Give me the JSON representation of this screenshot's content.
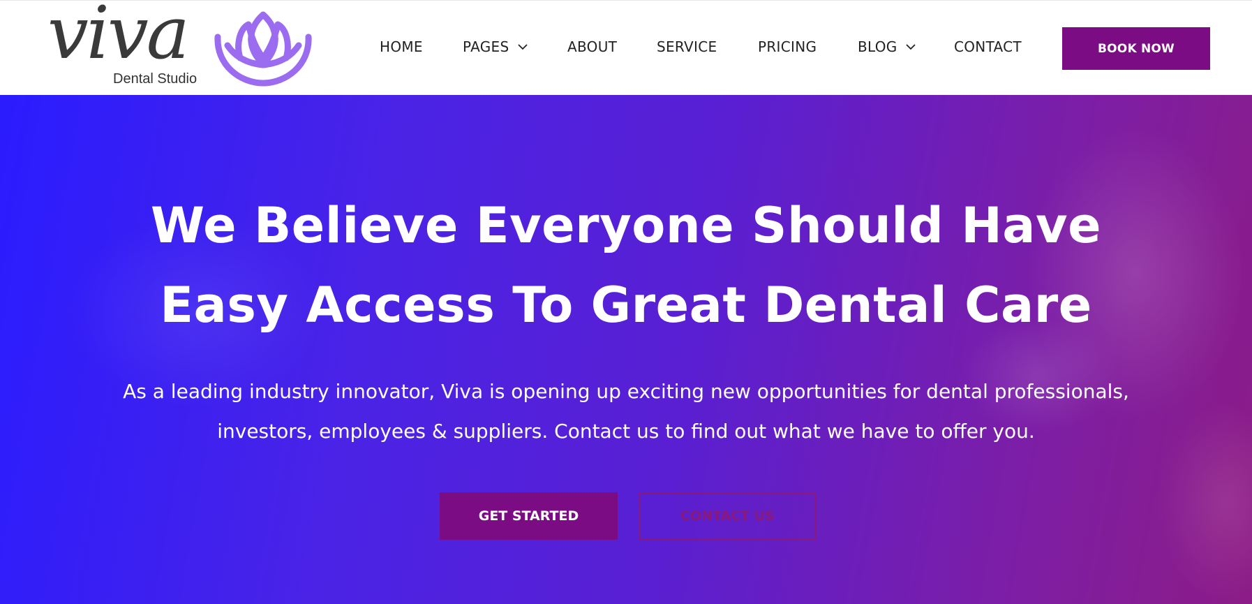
{
  "brand": {
    "name": "viva",
    "subtitle": "Dental Studio",
    "accent_color": "#9b6bf0",
    "primary_color": "#7b0c84"
  },
  "nav": {
    "items": [
      {
        "label": "HOME",
        "has_dropdown": false
      },
      {
        "label": "PAGES",
        "has_dropdown": true
      },
      {
        "label": "ABOUT",
        "has_dropdown": false
      },
      {
        "label": "SERVICE",
        "has_dropdown": false
      },
      {
        "label": "PRICING",
        "has_dropdown": false
      },
      {
        "label": "BLOG",
        "has_dropdown": true
      },
      {
        "label": "CONTACT",
        "has_dropdown": false
      }
    ],
    "cta_label": "BOOK NOW",
    "dropdown_icon": "chevron-down-icon"
  },
  "hero": {
    "title_line1": "We Believe Everyone Should Have",
    "title_line2": "Easy Access To Great Dental Care",
    "subtitle_line1": "As a leading industry innovator, Viva is opening up exciting new opportunities for dental professionals,",
    "subtitle_line2": "investors, employees & suppliers. Contact us to find out what we have to offer you.",
    "primary_button": "GET STARTED",
    "secondary_button": "CONTACT US",
    "gradient_start": "#2a1cff",
    "gradient_end": "#8c1c86"
  }
}
